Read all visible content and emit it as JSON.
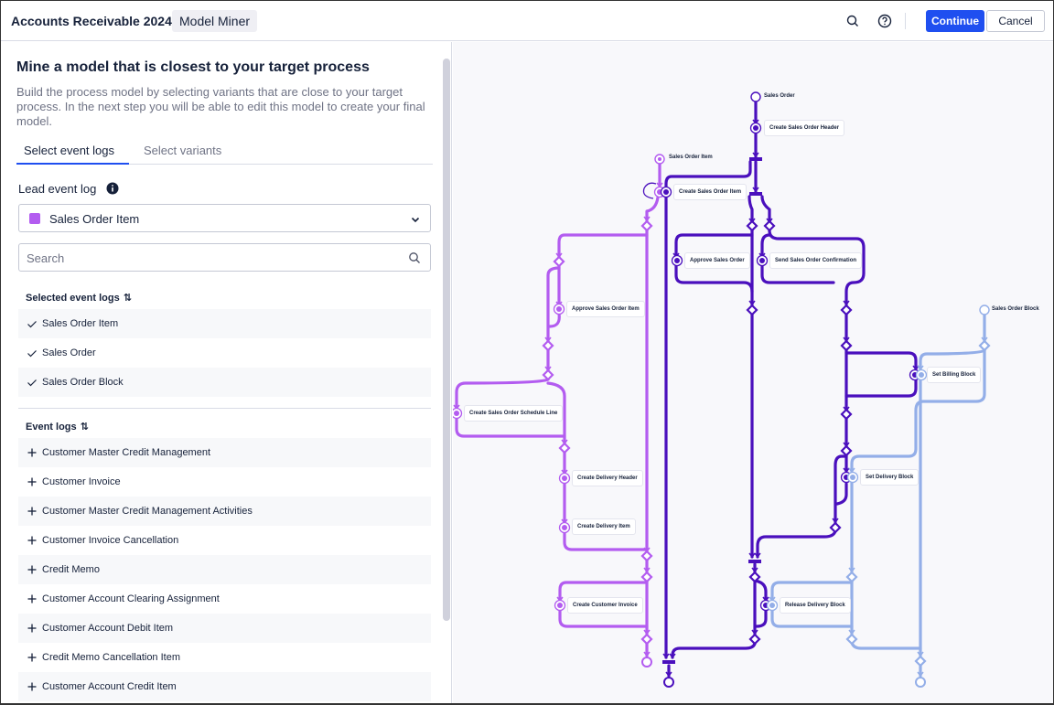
{
  "topbar": {
    "title": "Accounts Receivable 2024",
    "chip": "Model Miner",
    "search_icon": "search-icon",
    "help_icon": "help-circle-icon",
    "continue_label": "Continue",
    "cancel_label": "Cancel",
    "primary_color": "#1f4ff0"
  },
  "panel": {
    "heading": "Mine a model that is closest to your target process",
    "description": "Build the process model by selecting variants that are close to your target process. In the next step you will be able to edit this model to create your final model.",
    "tabs": [
      {
        "label": "Select event logs",
        "active": true
      },
      {
        "label": "Select variants",
        "active": false
      }
    ],
    "lead_label": "Lead event log",
    "lead_select": {
      "value": "Sales Order Item",
      "color": "#b35cf0"
    },
    "search_placeholder": "Search",
    "selected_title": "Selected event logs",
    "selected": [
      {
        "label": "Sales Order Item"
      },
      {
        "label": "Sales Order"
      },
      {
        "label": "Sales Order Block"
      }
    ],
    "event_logs_title": "Event logs",
    "event_logs": [
      {
        "label": "Customer Master Credit Management"
      },
      {
        "label": "Customer Invoice"
      },
      {
        "label": "Customer Master Credit Management Activities"
      },
      {
        "label": "Customer Invoice Cancellation"
      },
      {
        "label": "Credit Memo"
      },
      {
        "label": "Customer Account Clearing Assignment"
      },
      {
        "label": "Customer Account Debit Item"
      },
      {
        "label": "Credit Memo Cancellation Item"
      },
      {
        "label": "Customer Account Credit Item"
      }
    ]
  },
  "diagram": {
    "colors": {
      "sales_order_item": "#b35cf0",
      "sales_order": "#4a0fbd",
      "sales_order_block": "#93aee8"
    },
    "sources": [
      {
        "label": "Sales Order",
        "log": "sales_order"
      },
      {
        "label": "Sales Order Item",
        "log": "sales_order_item"
      },
      {
        "label": "Sales Order Block",
        "log": "sales_order_block"
      }
    ],
    "activities": [
      {
        "label": "Create Sales Order Header"
      },
      {
        "label": "Create Sales Order Item"
      },
      {
        "label": "Approve Sales Order"
      },
      {
        "label": "Send Sales Order Confirmation"
      },
      {
        "label": "Approve Sales Order Item"
      },
      {
        "label": "Set Billing Block"
      },
      {
        "label": "Create Sales Order Schedule Line"
      },
      {
        "label": "Create Delivery Header"
      },
      {
        "label": "Set Delivery Block"
      },
      {
        "label": "Create Delivery Item"
      },
      {
        "label": "Create Customer Invoice"
      },
      {
        "label": "Release Delivery Block"
      }
    ]
  }
}
